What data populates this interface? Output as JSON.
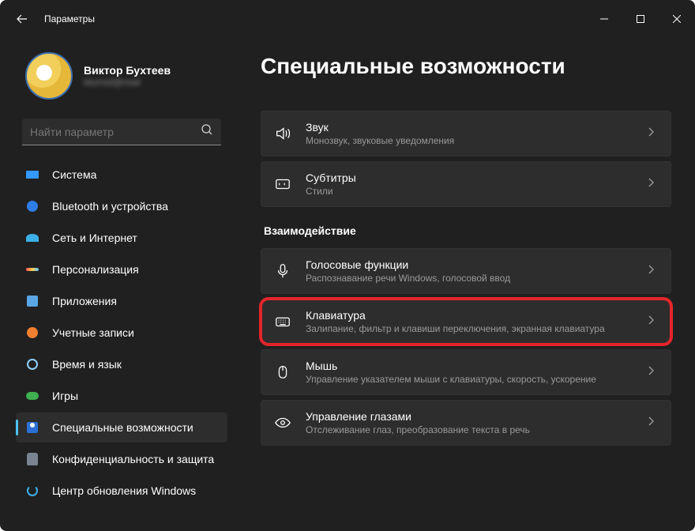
{
  "titlebar": {
    "app_title": "Параметры"
  },
  "profile": {
    "name": "Виктор Бухтеев",
    "email": "blurred@mail"
  },
  "search": {
    "placeholder": "Найти параметр"
  },
  "sidebar": {
    "items": [
      {
        "label": "Система"
      },
      {
        "label": "Bluetooth и устройства"
      },
      {
        "label": "Сеть и Интернет"
      },
      {
        "label": "Персонализация"
      },
      {
        "label": "Приложения"
      },
      {
        "label": "Учетные записи"
      },
      {
        "label": "Время и язык"
      },
      {
        "label": "Игры"
      },
      {
        "label": "Специальные возможности"
      },
      {
        "label": "Конфиденциальность и защита"
      },
      {
        "label": "Центр обновления Windows"
      }
    ]
  },
  "page": {
    "title": "Специальные возможности",
    "section2": "Взаимодействие"
  },
  "cards": {
    "sound": {
      "title": "Звук",
      "sub": "Монозвук, звуковые уведомления"
    },
    "captions": {
      "title": "Субтитры",
      "sub": "Стили"
    },
    "speech": {
      "title": "Голосовые функции",
      "sub": "Распознавание речи Windows, голосовой ввод"
    },
    "keyboard": {
      "title": "Клавиатура",
      "sub": "Залипание, фильтр и клавиши переключения, экранная клавиатура"
    },
    "mouse": {
      "title": "Мышь",
      "sub": "Управление указателем мыши с клавиатуры, скорость, ускорение"
    },
    "eye": {
      "title": "Управление глазами",
      "sub": "Отслеживание глаз, преобразование текста в речь"
    }
  }
}
